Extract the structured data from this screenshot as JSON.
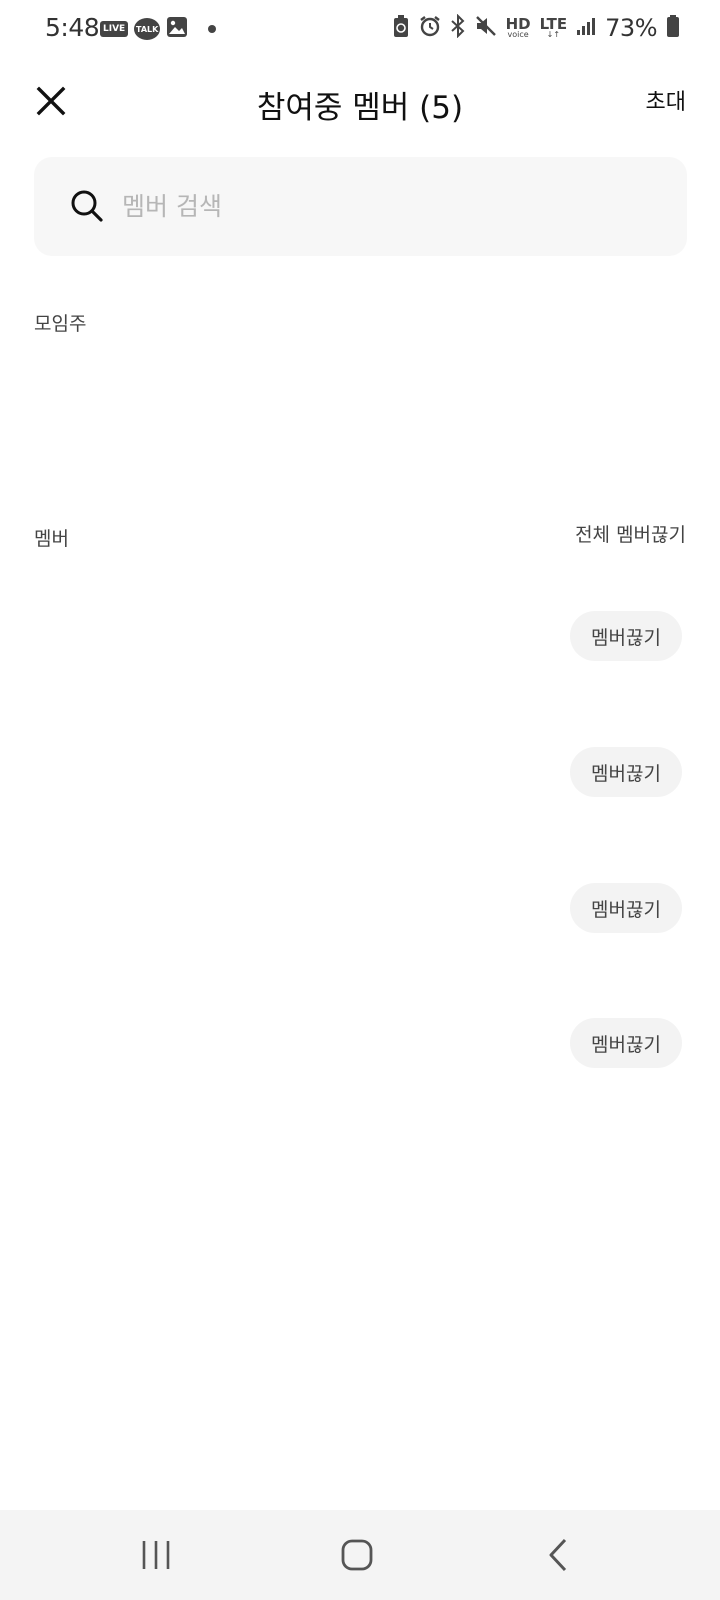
{
  "status_bar": {
    "time": "5:48",
    "live_badge": "LIVE",
    "talk_badge": "TALK",
    "hd_label": "HD",
    "hd_sub": "voice",
    "lte_label": "LTE",
    "battery_percent": "73%"
  },
  "header": {
    "title": "참여중 멤버 (5)",
    "invite_label": "초대"
  },
  "search": {
    "placeholder": "멤버 검색",
    "value": ""
  },
  "sections": {
    "owner_label": "모임주",
    "members_label": "멤버",
    "kick_all_label": "전체 멤버끊기"
  },
  "members": [
    {
      "kick_label": "멤버끊기"
    },
    {
      "kick_label": "멤버끊기"
    },
    {
      "kick_label": "멤버끊기"
    },
    {
      "kick_label": "멤버끊기"
    }
  ],
  "nav": {
    "recent_icon": "recent-apps-icon",
    "home_icon": "home-icon",
    "back_icon": "back-icon"
  }
}
